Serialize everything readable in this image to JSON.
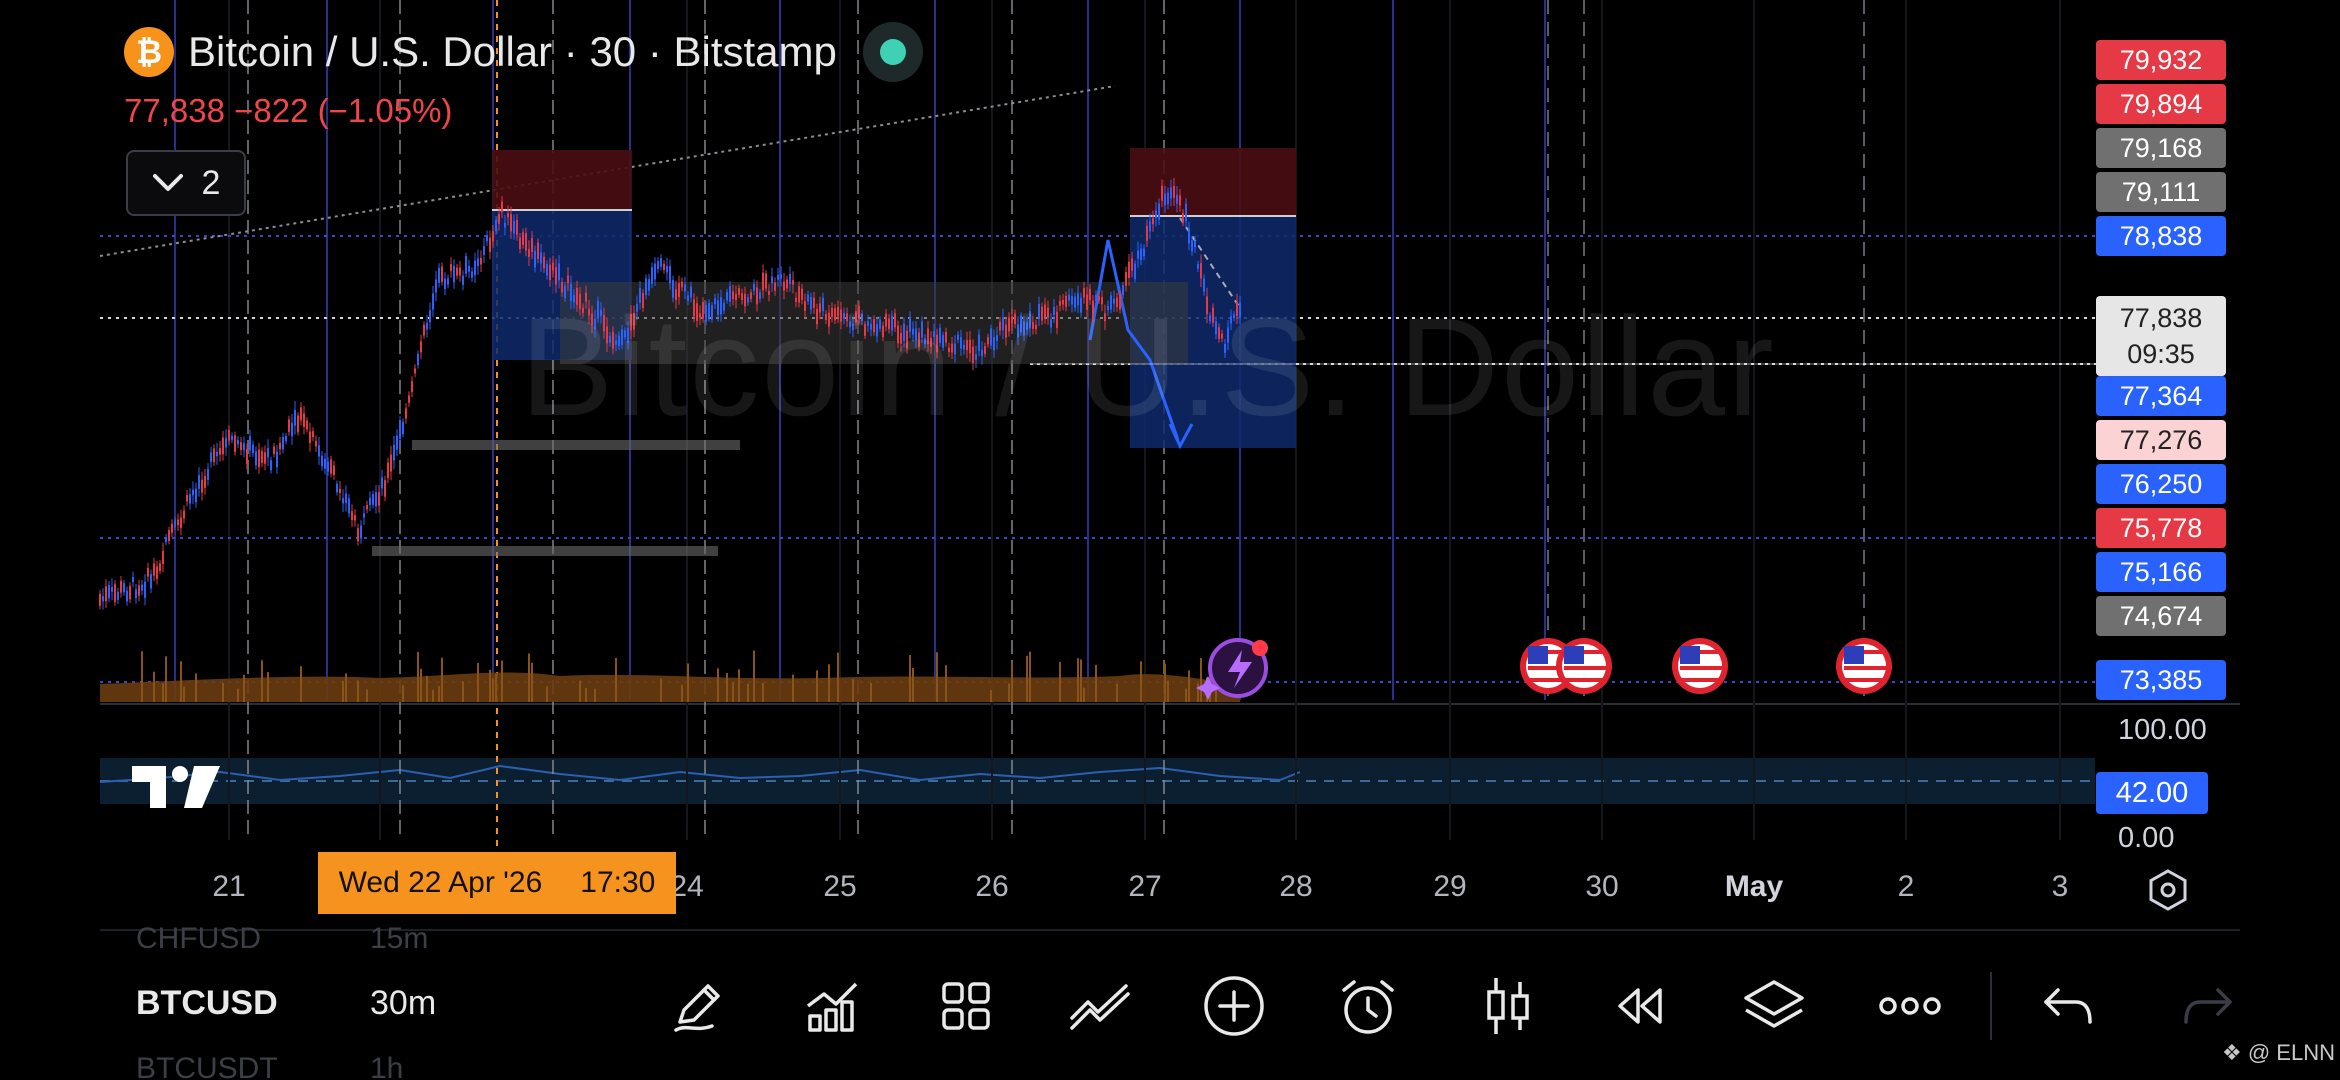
{
  "header": {
    "logo_glyph": "₿",
    "title": "Bitcoin / U.S. Dollar · 30 · Bitstamp",
    "price_change": "77,838  −822 (−1.05%)",
    "indicators_count": "2",
    "watermark": "Bitcoin / U.S. Dollar"
  },
  "price_axis": {
    "tags": [
      {
        "label": "79,932",
        "style": "red"
      },
      {
        "label": "79,894",
        "style": "red"
      },
      {
        "label": "79,168",
        "style": "gray"
      },
      {
        "label": "79,111",
        "style": "gray"
      },
      {
        "label": "78,838",
        "style": "blue"
      },
      {
        "label": "77,364",
        "style": "blue"
      },
      {
        "label": "77,276",
        "style": "pink"
      },
      {
        "label": "76,250",
        "style": "blue"
      },
      {
        "label": "75,778",
        "style": "red"
      },
      {
        "label": "75,166",
        "style": "blue"
      },
      {
        "label": "74,674",
        "style": "gray"
      },
      {
        "label": "73,385",
        "style": "blue"
      }
    ],
    "current_price": "77,838",
    "countdown": "09:35"
  },
  "oscillator": {
    "max_label": "100.00",
    "value_label": "42.00",
    "min_label": "0.00"
  },
  "time_axis": {
    "labels": [
      "21",
      "24",
      "25",
      "26",
      "27",
      "28",
      "29",
      "30",
      "May",
      "2",
      "3"
    ],
    "crosshair_date": "Wed 22 Apr '26",
    "crosshair_time": "17:30"
  },
  "symbols": {
    "above": {
      "symbol": "CHFUSD",
      "tf": "15m"
    },
    "active": {
      "symbol": "BTCUSD",
      "tf": "30m"
    },
    "below": {
      "symbol": "BTCUSDT",
      "tf": "1h"
    }
  },
  "toolbar": {
    "icons": [
      "pencil-icon",
      "indicators-icon",
      "grid-icon",
      "trend-line-icon",
      "add-icon",
      "alert-icon",
      "candles-icon",
      "replay-icon",
      "layers-icon",
      "more-icon",
      "undo-icon",
      "redo-icon"
    ]
  },
  "credit": "@ ELNN",
  "colors": {
    "up": "#2962ff",
    "down": "#e53945",
    "accent": "#f6931e",
    "position_red": "#4a0d12",
    "position_blue": "#0e2a6b"
  }
}
